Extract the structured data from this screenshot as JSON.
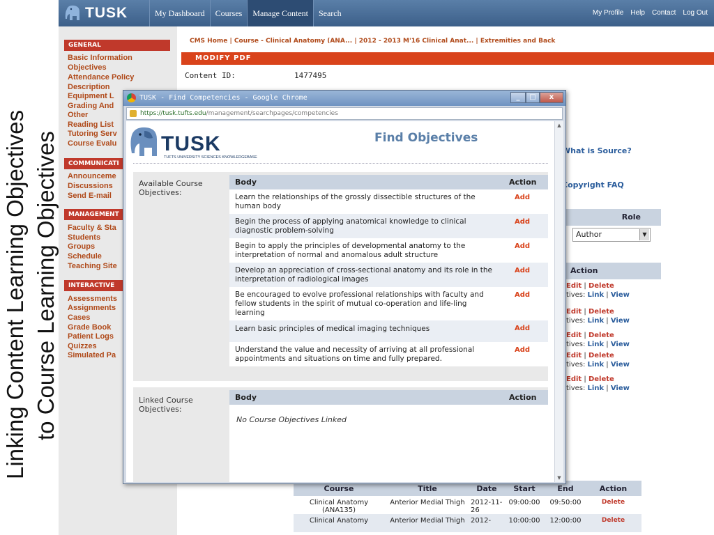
{
  "slide": {
    "title_line1": "Linking Content Learning Objectives",
    "title_line2": "to Course Learning Objectives"
  },
  "app": {
    "logo": "TUSK",
    "nav": [
      "My Dashboard",
      "Courses",
      "Manage Content",
      "Search"
    ],
    "nav_active": "Manage Content",
    "right_nav": [
      "My Profile",
      "Help",
      "Contact",
      "Log Out"
    ]
  },
  "sidebar": {
    "general": {
      "title": "GENERAL",
      "items": [
        "Basic Information",
        "Objectives",
        "Attendance Policy",
        "Description",
        "Equipment L",
        "Grading And",
        "Other",
        "Reading List",
        "Tutoring Serv",
        "Course Evalu"
      ]
    },
    "communication": {
      "title": "COMMUNICATI",
      "items": [
        "Announceme",
        "Discussions",
        "Send E-mail"
      ]
    },
    "management": {
      "title": "MANAGEMENT",
      "items": [
        "Faculty & Sta",
        "Students",
        "Groups",
        "Schedule",
        "Teaching Site"
      ]
    },
    "interactive": {
      "title": "INTERACTIVE",
      "items": [
        "Assessments",
        "Assignments",
        "Cases",
        "Grade Book",
        "Patient Logs",
        "Quizzes",
        "Simulated Pa"
      ]
    }
  },
  "page": {
    "breadcrumb": "CMS Home | Course - Clinical Anatomy (ANA... | 2012 - 2013 M'16 Clinical Anat... | Extremities and Back",
    "section_bar": "MODIFY PDF",
    "content_id_label": "Content ID:",
    "content_id_value": "1477495",
    "what_is_source": "What is Source?",
    "copyright_faq": "Copyright FAQ",
    "role_header": "Role",
    "role_value": "Author",
    "action_header": "Action",
    "action_rows": [
      {
        "line1a": "Edit",
        "line1b": "Delete",
        "line2prefix": "tives:",
        "line2a": "Link",
        "line2b": "View"
      },
      {
        "line1a": "Edit",
        "line1b": "Delete",
        "line2prefix": "tives:",
        "line2a": "Link",
        "line2b": "View"
      },
      {
        "line1a": "Edit",
        "line1b": "Delete",
        "line2prefix": "tives:",
        "line2a": "Link",
        "line2b": "View"
      },
      {
        "line1a": "Edit",
        "line1b": "Delete",
        "line2prefix": "tives:",
        "line2a": "Link",
        "line2b": "View"
      },
      {
        "line1a": "Edit",
        "line1b": "Delete",
        "line2prefix": "tives:",
        "line2a": "Link",
        "line2b": "View"
      }
    ],
    "schedule": {
      "headers": [
        "Course",
        "Title",
        "Date",
        "Start",
        "End",
        "Action"
      ],
      "rows": [
        [
          "Clinical Anatomy (ANA135)",
          "Anterior Medial Thigh",
          "2012-11-26",
          "09:00:00",
          "09:50:00",
          "Delete"
        ],
        [
          "Clinical Anatomy",
          "Anterior Medial Thigh",
          "2012-",
          "10:00:00",
          "12:00:00",
          "Delete"
        ]
      ]
    }
  },
  "popup": {
    "window_title": "TUSK - Find Competencies - Google Chrome",
    "url_domain": "https://tusk.tufts.edu",
    "url_path": "/management/searchpages/competencies",
    "logo": "TUSK",
    "logo_sub": "TUFTS UNIVERSITY SCIENCES KNOWLEDGEBASE",
    "heading": "Find Objectives",
    "available_label": "Available Course Objectives:",
    "linked_label": "Linked Course Objectives:",
    "col_body": "Body",
    "col_action": "Action",
    "add_label": "Add",
    "available": [
      "Learn the relationships of the grossly dissectible structures of the human body",
      "Begin the process of applying anatomical knowledge to clinical diagnostic problem-solving",
      "Begin to apply the principles of developmental anatomy to the interpretation of normal and anomalous adult structure",
      "Develop an appreciation of cross-sectional anatomy and its role in the interpretation of radiological images",
      "Be encouraged to evolve professional relationships with faculty and fellow students in the spirit of mutual co-operation and life-ling learning",
      "Learn basic principles of medical imaging techniques",
      "Understand the value and necessity of arriving at all professional appointments and situations on time and fully prepared."
    ],
    "no_linked": "No Course Objectives Linked"
  }
}
